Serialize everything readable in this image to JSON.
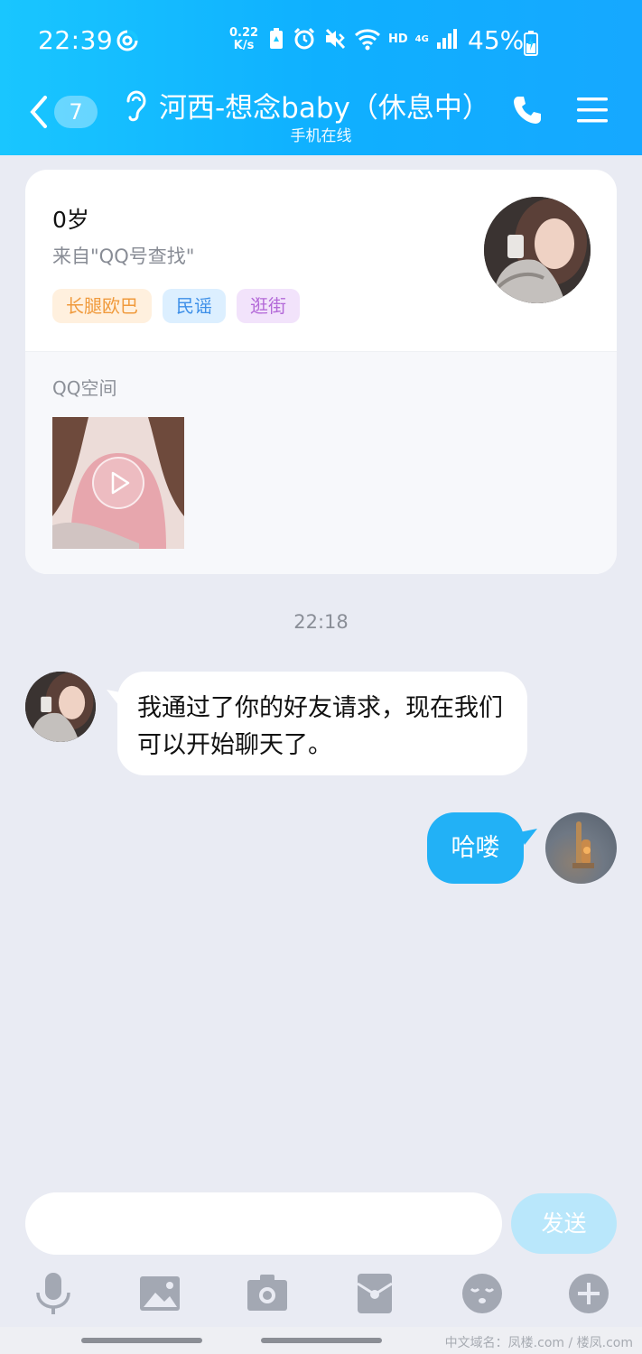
{
  "status_bar": {
    "time": "22:39",
    "speed_value": "0.22",
    "speed_unit": "K/s",
    "hd": "HD",
    "network": "4G",
    "battery_percent": "45%"
  },
  "header": {
    "unread_count": "7",
    "contact_name": "河西-想念baby（休息中）",
    "contact_status": "手机在线"
  },
  "profile": {
    "age": "0岁",
    "source": "来自\"QQ号查找\"",
    "tags": [
      "长腿欧巴",
      "民谣",
      "逛街"
    ],
    "qzone_title": "QQ空间"
  },
  "messages": {
    "timestamp": "22:18",
    "received_text": "我通过了你的好友请求，现在我们可以开始聊天了。",
    "sent_text": "哈喽"
  },
  "composer": {
    "input_value": "",
    "send_label": "发送"
  },
  "toolbar": {
    "items": [
      "microphone-icon",
      "image-icon",
      "camera-icon",
      "red-packet-icon",
      "emoji-icon",
      "plus-icon"
    ]
  },
  "watermark": "中文域名：凤楼.com / 楼凤.com",
  "colors": {
    "header_gradient_start": "#19c6ff",
    "header_gradient_end": "#16a8ff",
    "sent_bubble": "#22b1f6",
    "send_button_disabled": "#b9e7fb",
    "chat_background": "#e9ebf3"
  }
}
